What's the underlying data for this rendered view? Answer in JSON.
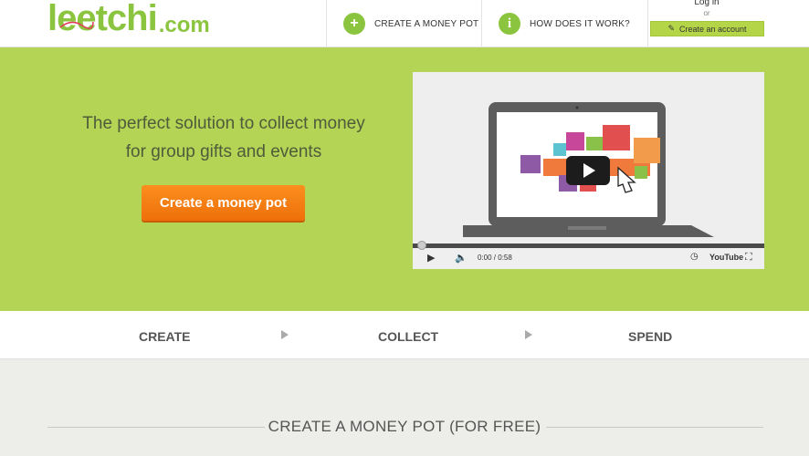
{
  "header": {
    "logo_text": "leetchi",
    "logo_suffix": ".com",
    "nav": [
      {
        "label": "CREATE A MONEY POT",
        "icon": "plus-icon"
      },
      {
        "label": "HOW DOES IT WORK?",
        "icon": "info-icon"
      }
    ],
    "login_label": "Log in",
    "or_label": "or",
    "create_account_label": "Create an account"
  },
  "hero": {
    "tagline_line1": "The perfect solution to collect money",
    "tagline_line2": "for group gifts and events",
    "cta_label": "Create a money pot",
    "video": {
      "time": "0:00 / 0:58",
      "progress": 0.0,
      "platform": "YouTube"
    }
  },
  "steps": [
    "CREATE",
    "COLLECT",
    "SPEND"
  ],
  "section_title": "CREATE A MONEY POT (FOR FREE)",
  "colors": {
    "brand_green": "#8bc53f",
    "hero_bg": "#b4d456",
    "cta_orange": "#f5821f"
  }
}
